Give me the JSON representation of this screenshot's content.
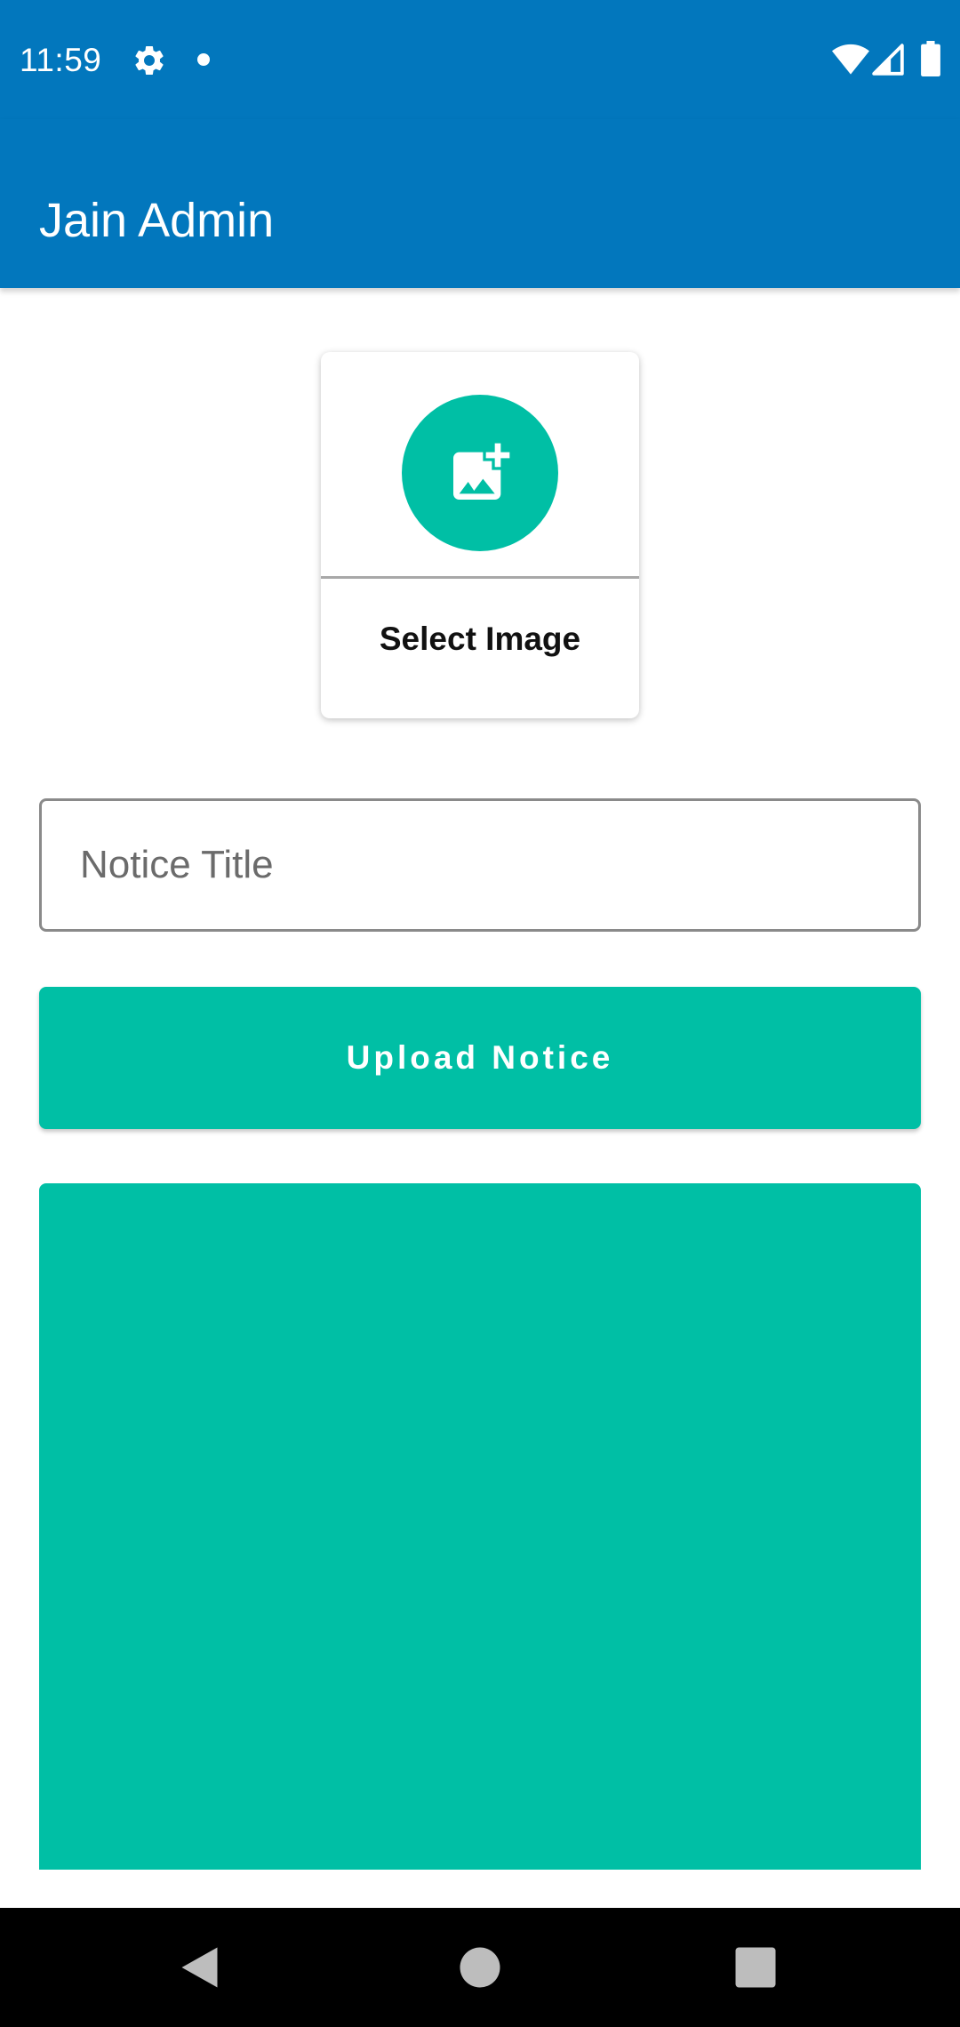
{
  "status_bar": {
    "time": "11:59",
    "icons": [
      "gear-icon",
      "notification-dot-icon",
      "wifi-icon",
      "cell-signal-icon",
      "battery-icon"
    ]
  },
  "app_bar": {
    "title": "Jain Admin"
  },
  "select_image": {
    "label": "Select Image",
    "icon": "add-photo-icon"
  },
  "notice_title_input": {
    "placeholder": "Notice Title",
    "value": ""
  },
  "upload_button": {
    "label": "Upload Notice"
  },
  "nav_bar": {
    "icons": [
      "back-icon",
      "home-icon",
      "recents-icon"
    ]
  },
  "colors": {
    "primary": "#0277BD",
    "accent": "#00BFA5",
    "nav_background": "#000000"
  }
}
